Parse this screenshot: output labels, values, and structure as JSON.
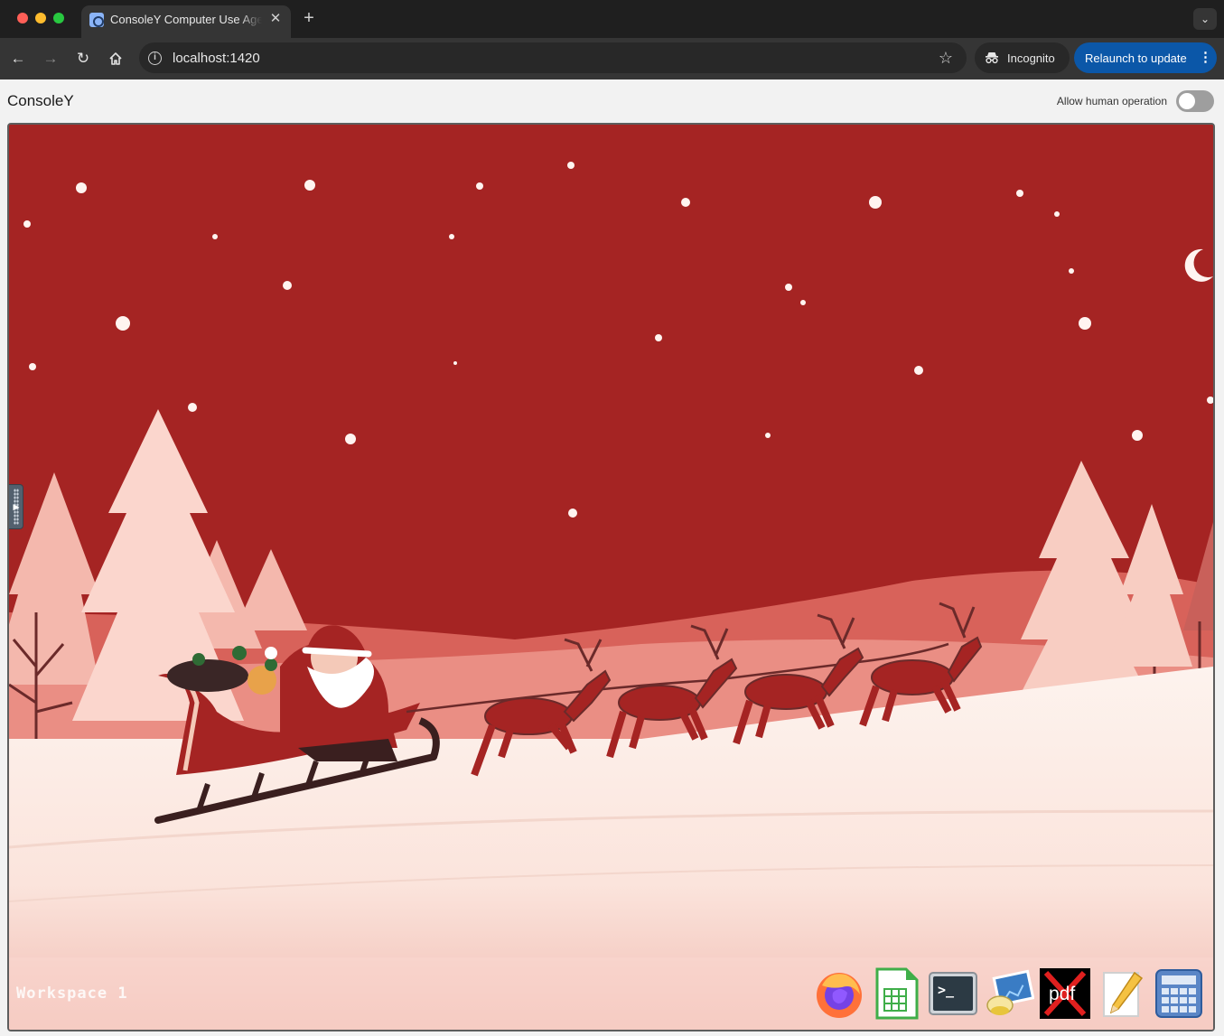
{
  "browser": {
    "tab_title": "ConsoleY Computer Use Agent",
    "url": "localhost:1420",
    "incognito_label": "Incognito",
    "relaunch_label": "Relaunch to update",
    "icons": [
      "back-icon",
      "forward-icon",
      "reload-icon",
      "home-icon",
      "site-info-icon",
      "bookmark-star-icon",
      "incognito-icon",
      "kebab-icon",
      "close-icon",
      "plus-icon",
      "chevron-down-icon"
    ]
  },
  "app": {
    "title": "ConsoleY",
    "human_operation_label": "Allow human operation",
    "human_operation_enabled": false
  },
  "desktop": {
    "workspace_label": "Workspace 1",
    "dock_apps": [
      {
        "name": "Firefox",
        "icon": "firefox-icon"
      },
      {
        "name": "Spreadsheet",
        "icon": "spreadsheet-icon"
      },
      {
        "name": "Terminal",
        "icon": "terminal-icon",
        "glyph": ">_"
      },
      {
        "name": "Image Viewer",
        "icon": "image-viewer-icon"
      },
      {
        "name": "PDF",
        "icon": "pdf-icon",
        "glyph": "pdf"
      },
      {
        "name": "Text Editor",
        "icon": "text-editor-icon"
      },
      {
        "name": "Calculator",
        "icon": "calculator-icon"
      }
    ]
  },
  "colors": {
    "sky": "#a52423",
    "accent_button": "#0b57a8",
    "snow": "#fbe9e3"
  }
}
